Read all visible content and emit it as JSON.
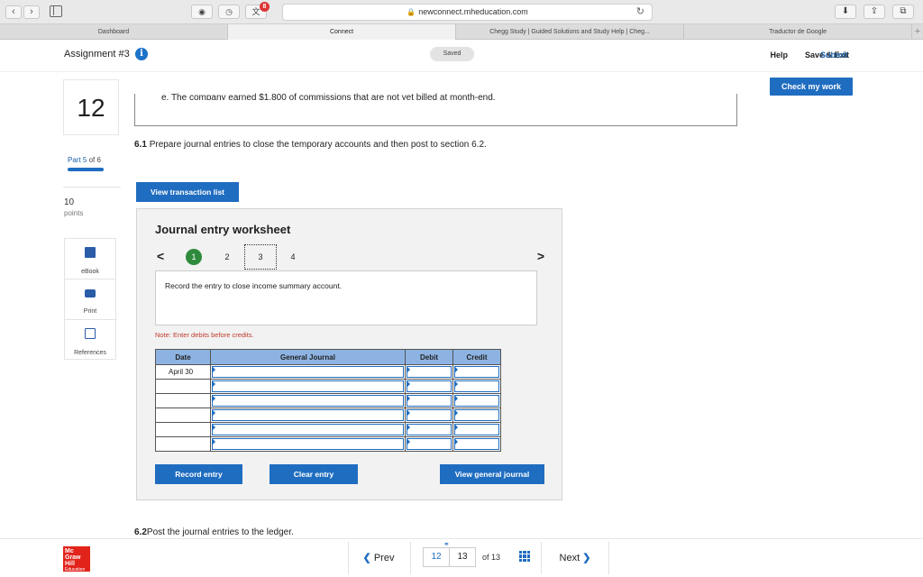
{
  "browser": {
    "url": "newconnect.mheducation.com",
    "extension_badge": "8",
    "tabs": [
      {
        "label": "Dashboard",
        "active": false
      },
      {
        "label": "Connect",
        "active": true
      },
      {
        "label": "Chegg Study | Guided Solutions and Study Help | Cheg...",
        "active": false
      },
      {
        "label": "Traductor de Google",
        "active": false
      }
    ],
    "new_tab": "+"
  },
  "header": {
    "assignment_title": "Assignment #3",
    "info_glyph": "i",
    "saved_label": "Saved",
    "help_label": "Help",
    "save_exit_label": "Save & Exit",
    "submit_label": "Submit",
    "check_work_label": "Check my work"
  },
  "left_panel": {
    "question_number": "12",
    "part_prefix": "Part",
    "part_current": "5",
    "part_of": "of 6",
    "points_value": "10",
    "points_label": "points",
    "tools": [
      {
        "label": "eBook",
        "icon": "book-icon"
      },
      {
        "label": "Print",
        "icon": "printer-icon"
      },
      {
        "label": "References",
        "icon": "references-icon"
      }
    ]
  },
  "content": {
    "cut_text": "e. The company earned $1,800 of commissions that are not yet billed at month-end.",
    "instruction_num": "6.1",
    "instruction_text": "Prepare journal entries to close the temporary accounts and then post to section 6.2.",
    "view_tx_label": "View transaction list",
    "post_num": "6.2",
    "post_text": "Post the journal entries to the ledger."
  },
  "worksheet": {
    "title": "Journal entry worksheet",
    "prev_glyph": "<",
    "next_glyph": ">",
    "pages": [
      "1",
      "2",
      "3",
      "4"
    ],
    "completed_page": "1",
    "current_page": "3",
    "record_text": "Record the entry to close income summary account.",
    "note": "Note: Enter debits before credits.",
    "columns": [
      "Date",
      "General Journal",
      "Debit",
      "Credit"
    ],
    "rows": [
      {
        "date": "April 30"
      },
      {
        "date": ""
      },
      {
        "date": ""
      },
      {
        "date": ""
      },
      {
        "date": ""
      },
      {
        "date": ""
      }
    ],
    "record_entry_label": "Record entry",
    "clear_entry_label": "Clear entry",
    "view_journal_label": "View general journal"
  },
  "footer": {
    "logo_lines": [
      "Mc",
      "Graw",
      "Hill",
      "Education"
    ],
    "prev_label": "Prev",
    "current_page": "12",
    "next_page": "13",
    "of_total": "of 13",
    "next_label": "Next",
    "prev_glyph": "❮",
    "next_glyph": "❯"
  },
  "colors": {
    "accent": "#1f6dc0",
    "table_header": "#8db3e2",
    "completed": "#2e8b3d",
    "note_red": "#c0392b",
    "logo_red": "#e2231a"
  }
}
